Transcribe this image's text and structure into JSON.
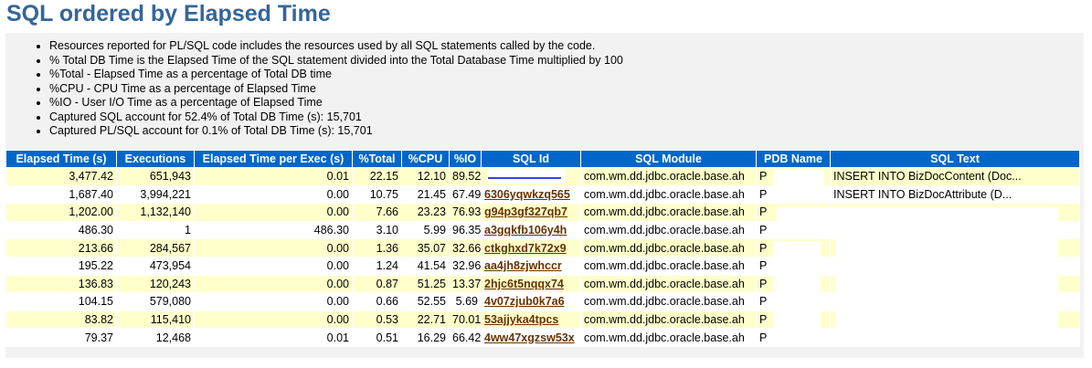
{
  "title": "SQL ordered by Elapsed Time",
  "notes": [
    "Resources reported for PL/SQL code includes the resources used by all SQL statements called by the code.",
    "% Total DB Time is the Elapsed Time of the SQL statement divided into the Total Database Time multiplied by 100",
    "%Total - Elapsed Time as a percentage of Total DB time",
    "%CPU - CPU Time as a percentage of Elapsed Time",
    "%IO - User I/O Time as a percentage of Elapsed Time",
    "Captured SQL account for 52.4% of Total DB Time (s): 15,701",
    "Captured PL/SQL account for 0.1% of Total DB Time (s): 15,701"
  ],
  "columns": [
    "Elapsed Time (s)",
    "Executions",
    "Elapsed Time per Exec (s)",
    "%Total",
    "%CPU",
    "%IO",
    "SQL Id",
    "SQL Module",
    "PDB Name",
    "SQL Text"
  ],
  "rows": [
    {
      "elapsed": "3,477.42",
      "execs": "651,943",
      "per_exec": "0.01",
      "total": "22.15",
      "cpu": "12.10",
      "io": "89.52",
      "sql_id": "",
      "module": "com.wm.dd.jdbc.oracle.base.ah",
      "pdb": "P",
      "text": "INSERT INTO BizDocContent (Doc..."
    },
    {
      "elapsed": "1,687.40",
      "execs": "3,994,221",
      "per_exec": "0.00",
      "total": "10.75",
      "cpu": "21.45",
      "io": "67.49",
      "sql_id": "6306yqwkzq565",
      "module": "com.wm.dd.jdbc.oracle.base.ah",
      "pdb": "P",
      "text": "INSERT INTO BizDocAttribute (D..."
    },
    {
      "elapsed": "1,202.00",
      "execs": "1,132,140",
      "per_exec": "0.00",
      "total": "7.66",
      "cpu": "23.23",
      "io": "76.93",
      "sql_id": "g94p3gf327qb7",
      "module": "com.wm.dd.jdbc.oracle.base.ah",
      "pdb": "P",
      "text": ""
    },
    {
      "elapsed": "486.30",
      "execs": "1",
      "per_exec": "486.30",
      "total": "3.10",
      "cpu": "5.99",
      "io": "96.35",
      "sql_id": "a3gqkfb106y4h",
      "module": "com.wm.dd.jdbc.oracle.base.ah",
      "pdb": "P",
      "text": ""
    },
    {
      "elapsed": "213.66",
      "execs": "284,567",
      "per_exec": "0.00",
      "total": "1.36",
      "cpu": "35.07",
      "io": "32.66",
      "sql_id": "ctkghxd7k72x9",
      "module": "com.wm.dd.jdbc.oracle.base.ah",
      "pdb": "P",
      "text": ""
    },
    {
      "elapsed": "195.22",
      "execs": "473,954",
      "per_exec": "0.00",
      "total": "1.24",
      "cpu": "41.54",
      "io": "32.96",
      "sql_id": "aa4jh8zjwhccr",
      "module": "com.wm.dd.jdbc.oracle.base.ah",
      "pdb": "P",
      "text": ""
    },
    {
      "elapsed": "136.83",
      "execs": "120,243",
      "per_exec": "0.00",
      "total": "0.87",
      "cpu": "51.25",
      "io": "13.37",
      "sql_id": "2hjc6t5nqqx74",
      "module": "com.wm.dd.jdbc.oracle.base.ah",
      "pdb": "P",
      "text": ""
    },
    {
      "elapsed": "104.15",
      "execs": "579,080",
      "per_exec": "0.00",
      "total": "0.66",
      "cpu": "52.55",
      "io": "5.69",
      "sql_id": "4v07zjub0k7a6",
      "module": "com.wm.dd.jdbc.oracle.base.ah",
      "pdb": "P",
      "text": ""
    },
    {
      "elapsed": "83.82",
      "execs": "115,410",
      "per_exec": "0.00",
      "total": "0.53",
      "cpu": "22.71",
      "io": "70.01",
      "sql_id": "53ajjyka4tpcs",
      "module": "com.wm.dd.jdbc.oracle.base.ah",
      "pdb": "P",
      "text": ""
    },
    {
      "elapsed": "79.37",
      "execs": "12,468",
      "per_exec": "0.01",
      "total": "0.51",
      "cpu": "16.29",
      "io": "66.42",
      "sql_id": "4ww47xgzsw53x",
      "module": "com.wm.dd.jdbc.oracle.base.ah",
      "pdb": "P",
      "text": ""
    }
  ]
}
